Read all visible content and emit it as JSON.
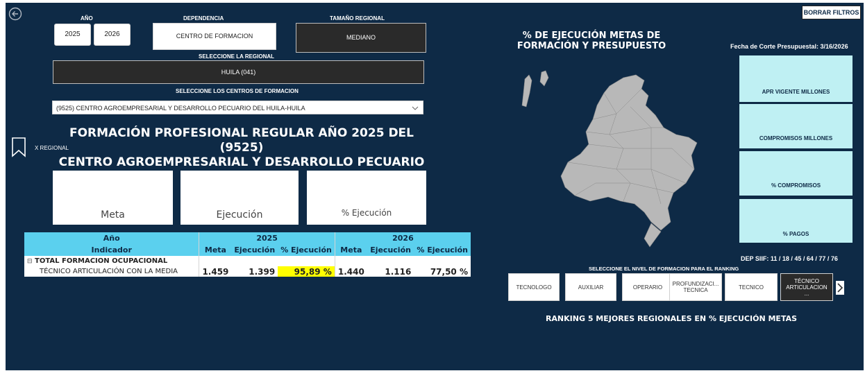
{
  "filters": {
    "year_label": "AÑO",
    "years": [
      "2025",
      "2026"
    ],
    "dependencia_label": "DEPENDENCIA",
    "dependencia_value": "CENTRO DE FORMACION",
    "tamano_label": "TAMAÑO REGIONAL",
    "tamano_value": "MEDIANO",
    "regional_label": "SELECCIONE LA REGIONAL",
    "regional_value": "HUILA (041)",
    "centros_label": "SELECCIONE LOS CENTROS DE FORMACION",
    "centros_value": "(9525) CENTRO AGROEMPRESARIAL Y DESARROLLO PECUARIO DEL HUILA-HUILA"
  },
  "header": {
    "borrar_label": "BORRAR FILTROS",
    "back_icon": "back-arrow-icon"
  },
  "bookmark": {
    "icon": "bookmark-icon",
    "label": "X REGIONAL"
  },
  "title": {
    "line1": "FORMACIÓN PROFESIONAL REGULAR AÑO 2025 DEL (9525)",
    "line2": "CENTRO AGROEMPRESARIAL Y DESARROLLO PECUARIO DEL H..."
  },
  "cards": [
    "Meta",
    "Ejecución",
    "% Ejecución"
  ],
  "table": {
    "year_header": "Año",
    "indicator_header": "Indicador",
    "years": [
      "2025",
      "2026"
    ],
    "cols": [
      "Meta",
      "Ejecución",
      "% Ejecución"
    ],
    "group_label": "TOTAL FORMACION OCUPACIONAL",
    "expand_icon": "⊟",
    "row_label": "TÉCNICO ARTICULACIÓN CON LA MEDIA",
    "row_values": [
      "1.459",
      "1.399",
      "95,89 %",
      "1.440",
      "1.116",
      "77,50 %"
    ],
    "highlight_color": "#ffff00"
  },
  "right": {
    "map_title_line1": "% DE EJECUCIÓN METAS DE",
    "map_title_line2": "FORMACIÓN Y PRESUPUESTO",
    "fecha_corte": "Fecha de Corte Presupuestal: 3/16/2026",
    "kpis": [
      "APR VIGENTE MILLONES",
      "COMPROMISOS MILLONES",
      "% COMPROMISOS",
      "% PAGOS"
    ],
    "dep_siif": "DEP SIIF: 11 / 18 / 45 / 64 / 77 / 76",
    "nivel_label": "SELECCIONE EL NIVEL DE FORMACION PARA EL RANKING",
    "niveles": [
      "TECNOLOGO",
      "AUXILIAR",
      "OPERARIO",
      "PROFUNDIZACI... TECNICA",
      "TECNICO",
      "TÉCNICO ARTICULACION ..."
    ],
    "next_icon": "chevron-right-icon",
    "ranking_title": "RANKING 5 MEJORES REGIONALES EN % EJECUCIÓN METAS"
  },
  "colors": {
    "background": "#0e2a46",
    "table_header": "#5bd0ee",
    "kpi_tile": "#bff0f3",
    "dark_slicer": "#2a2a2a",
    "map_fill": "#b8b8b8"
  }
}
